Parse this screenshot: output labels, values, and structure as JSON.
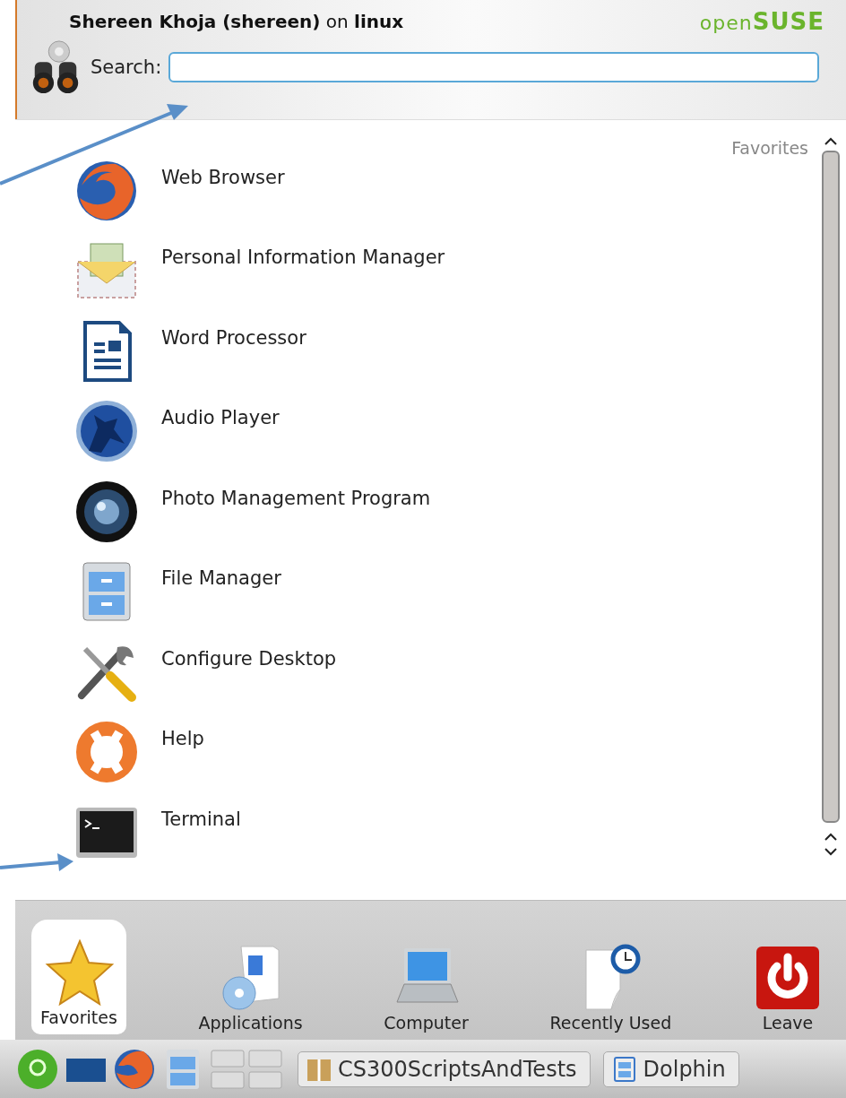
{
  "header": {
    "user_line": "**Shereen Khoja (shereen)** on **linux**",
    "brand_light": "open",
    "brand_bold": "SUSE",
    "search_label": "Search:"
  },
  "list": {
    "heading": "Favorites",
    "items": [
      {
        "label": "Web Browser"
      },
      {
        "label": "Personal Information Manager"
      },
      {
        "label": "Word Processor"
      },
      {
        "label": "Audio Player"
      },
      {
        "label": "Photo Management Program"
      },
      {
        "label": "File Manager"
      },
      {
        "label": "Configure Desktop"
      },
      {
        "label": "Help"
      },
      {
        "label": "Terminal"
      }
    ]
  },
  "tabs": [
    {
      "label": "Favorites",
      "selected": true
    },
    {
      "label": "Applications",
      "selected": false
    },
    {
      "label": "Computer",
      "selected": false
    },
    {
      "label": "Recently Used",
      "selected": false
    },
    {
      "label": "Leave",
      "selected": false
    }
  ],
  "taskbar": {
    "tasks": [
      {
        "label": "CS300ScriptsAndTests"
      },
      {
        "label": "Dolphin"
      }
    ]
  }
}
